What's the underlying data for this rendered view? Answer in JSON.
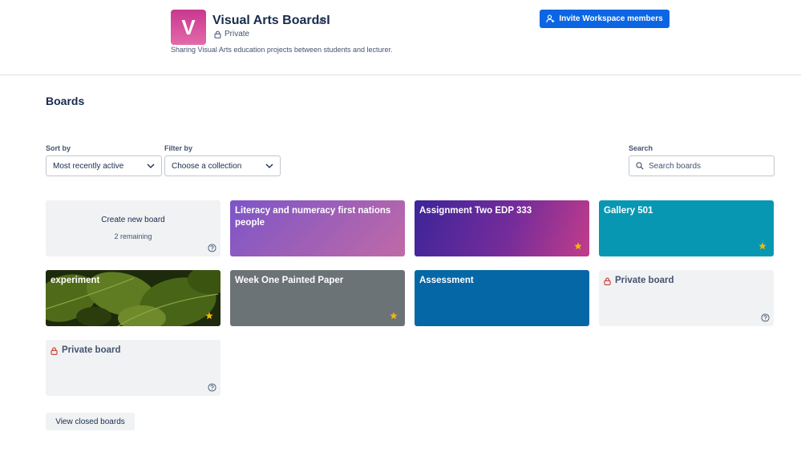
{
  "workspace": {
    "logo_letter": "V",
    "title": "Visual Arts BoardsI",
    "privacy": "Private",
    "description": "Sharing Visual Arts education projects between students and lecturer.",
    "invite_label": "Invite Workspace members"
  },
  "boards_heading": "Boards",
  "controls": {
    "sort_label": "Sort by",
    "sort_value": "Most recently active",
    "filter_label": "Filter by",
    "filter_value": "Choose a collection",
    "search_label": "Search",
    "search_placeholder": "Search boards"
  },
  "create_tile": {
    "label": "Create new board",
    "remaining": "2 remaining"
  },
  "boards": [
    {
      "title": "Literacy and numeracy first nations people",
      "starred": false
    },
    {
      "title": "Assignment Two EDP 333",
      "starred": true
    },
    {
      "title": "Gallery 501",
      "starred": true
    },
    {
      "title": "experiment",
      "starred": true
    },
    {
      "title": "Week One Painted Paper",
      "starred": true
    },
    {
      "title": "Assessment",
      "starred": false
    },
    {
      "title": "Private board",
      "private": true
    },
    {
      "title": "Private board",
      "private": true
    }
  ],
  "view_closed_label": "View closed boards",
  "colors": {
    "accent": "#0c66e4",
    "star": "#f5b700",
    "lock": "#c9372c",
    "gallery": "#0797b3",
    "assessment": "#0567a6",
    "week_one": "#6c7377"
  }
}
